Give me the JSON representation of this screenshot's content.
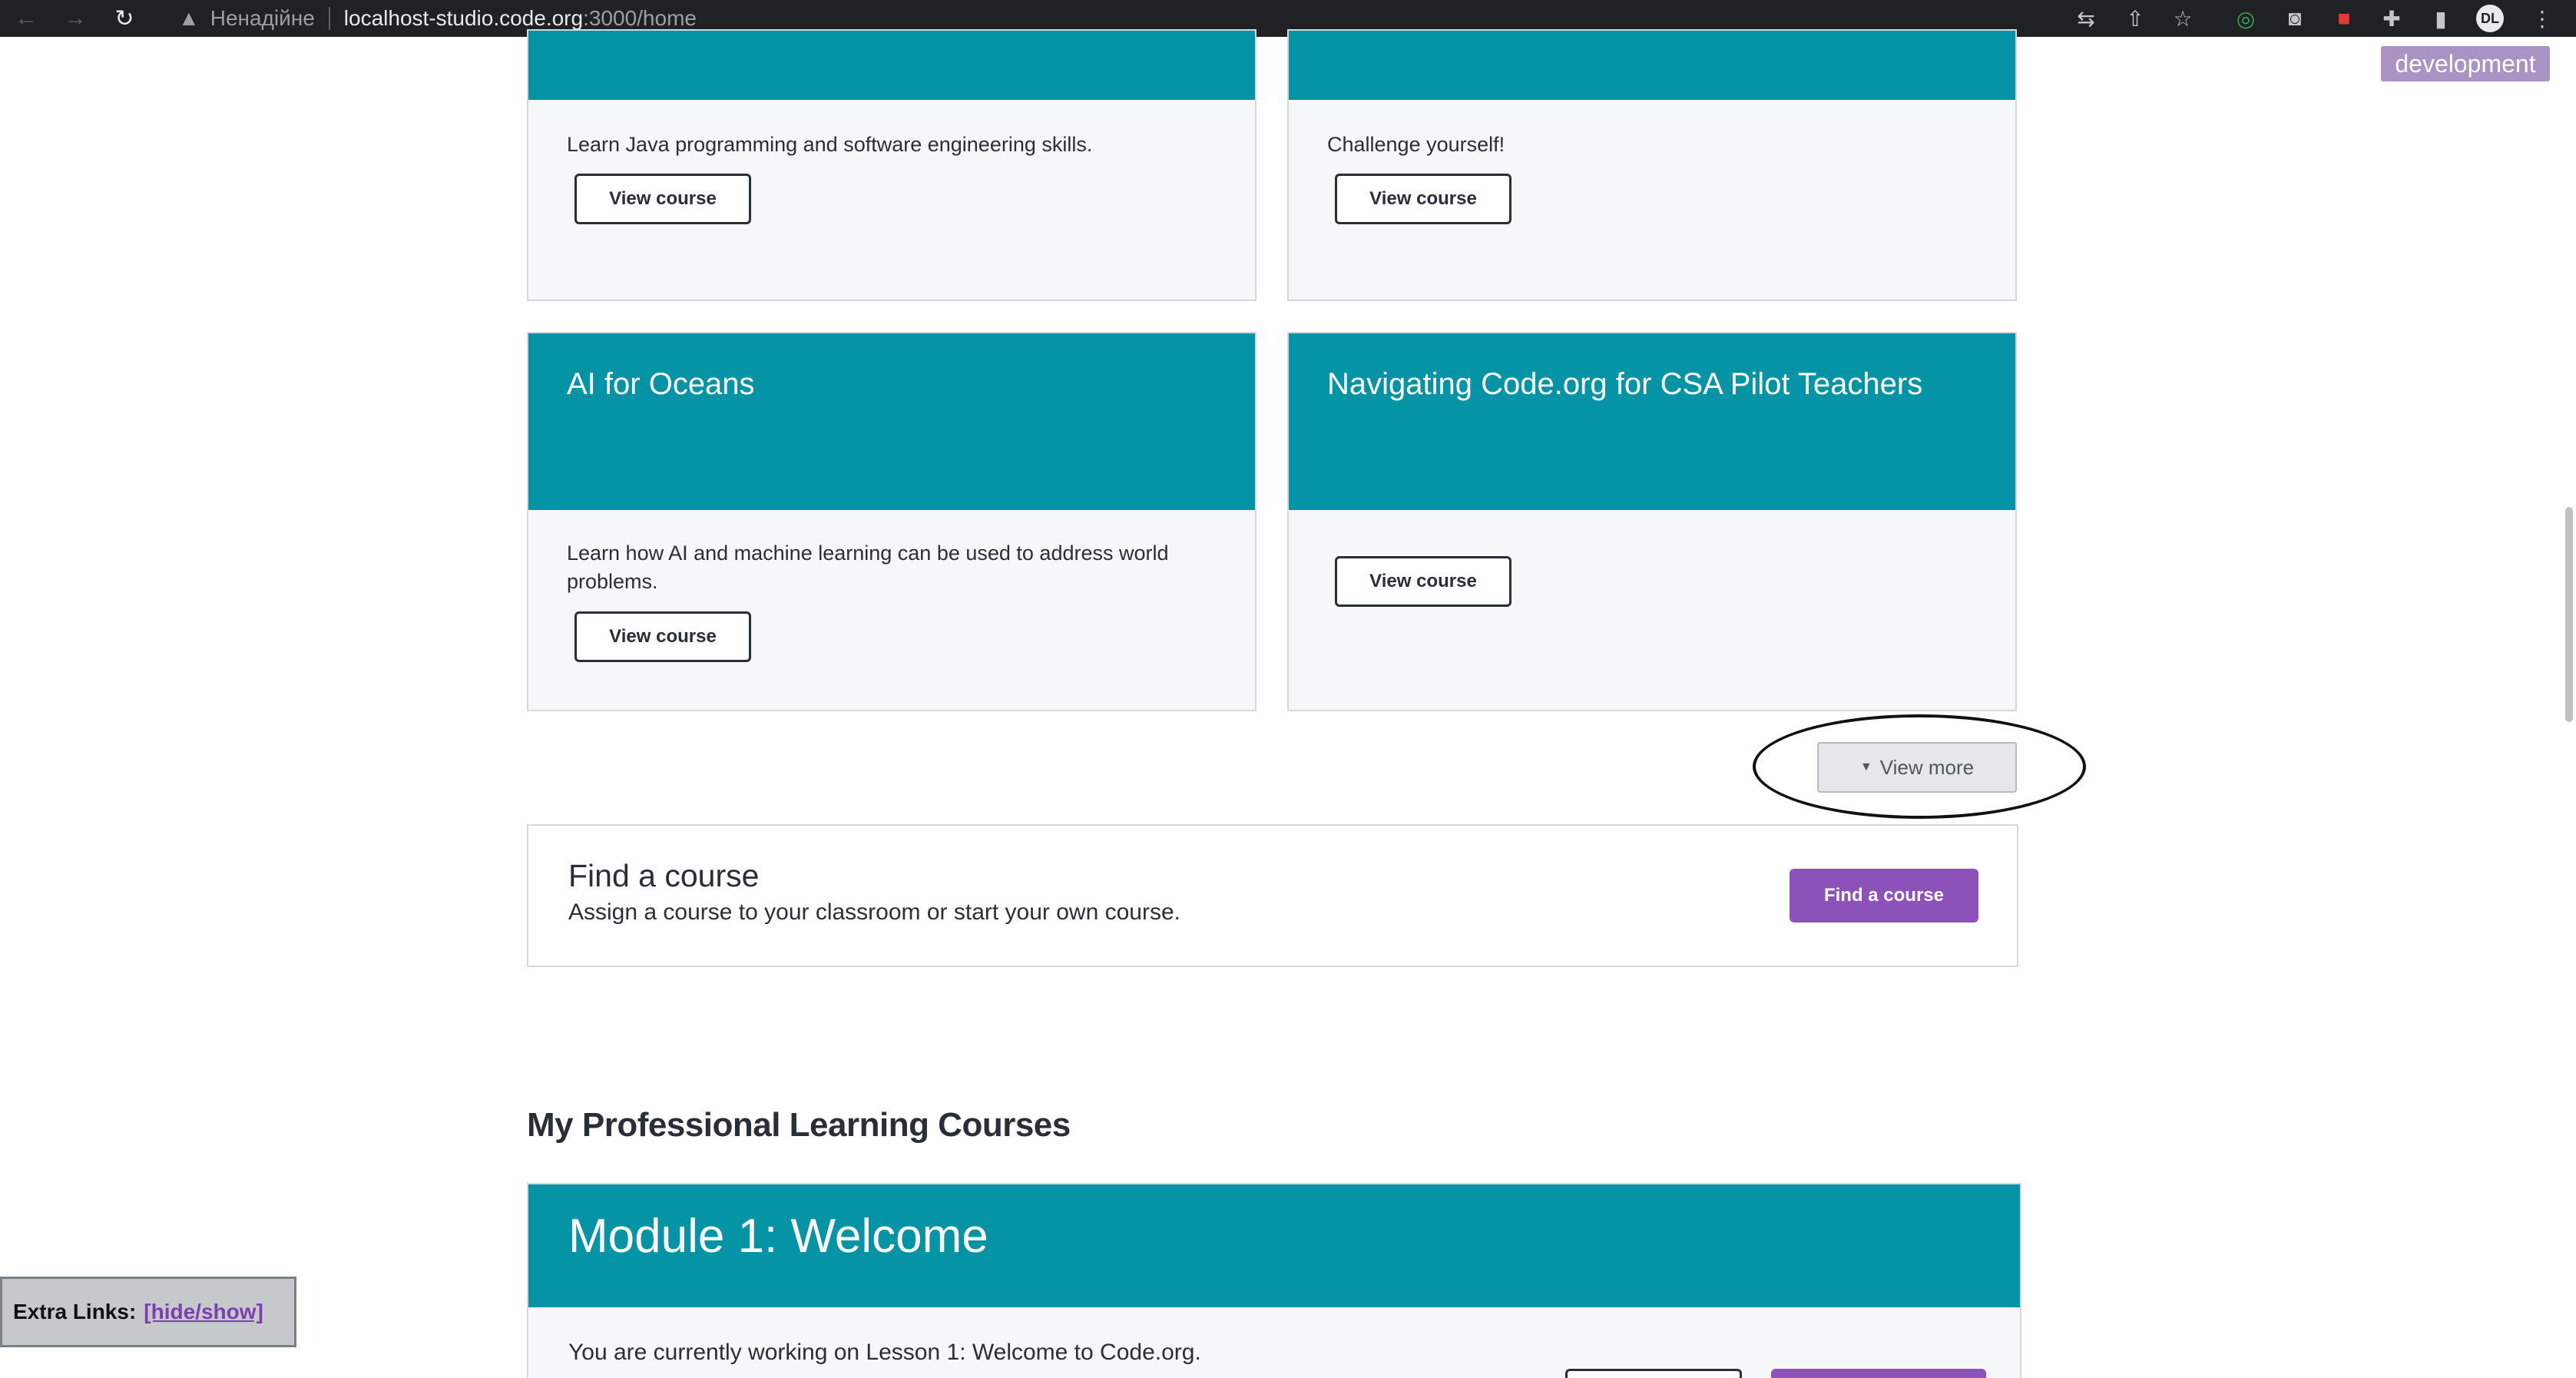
{
  "browser": {
    "insecure_label": "Ненадійне",
    "url_host": "localhost-studio.code.org",
    "url_rest": ":3000/home",
    "profile_initials": "DL"
  },
  "env_badge": "development",
  "course_cards": [
    {
      "title": "",
      "description": "Learn Java programming and software engineering skills.",
      "button": "View course"
    },
    {
      "title": "",
      "description": "Challenge yourself!",
      "button": "View course"
    },
    {
      "title": "AI for Oceans",
      "description": "Learn how AI and machine learning can be used to address world problems.",
      "button": "View course"
    },
    {
      "title": "Navigating Code.org for CSA Pilot Teachers",
      "description": "",
      "button": "View course"
    }
  ],
  "view_more": "View more",
  "find_course": {
    "title": "Find a course",
    "subtitle": "Assign a course to your classroom or start your own course.",
    "button": "Find a course"
  },
  "pl_section": {
    "title": "My Professional Learning Courses",
    "module_title": "Module 1: Welcome",
    "module_desc": "You are currently working on Lesson 1: Welcome to Code.org."
  },
  "extra_links": {
    "label": "Extra Links:",
    "link": "[hide/show]"
  },
  "colors": {
    "teal": "#0593a6",
    "purple": "#8c52ba",
    "card_bg": "#f6f7f9"
  }
}
